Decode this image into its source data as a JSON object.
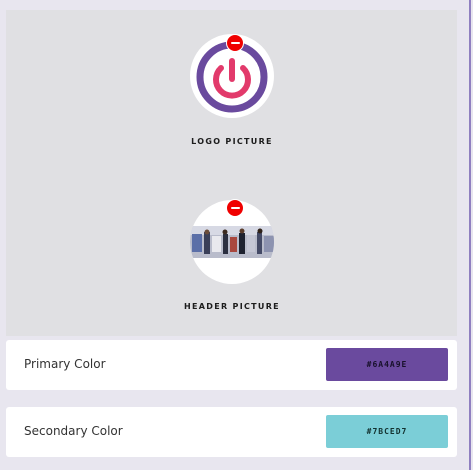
{
  "logo": {
    "label": "LOGO PICTURE",
    "icon": "power-icon",
    "remove_icon": "remove-icon",
    "ring_color": "#6a4a9e",
    "accent_color": "#e23a6b"
  },
  "header": {
    "label": "HEADER PICTURE",
    "image": "header-photo",
    "remove_icon": "remove-icon"
  },
  "colors": {
    "primary": {
      "label": "Primary Color",
      "value": "#6A4A9E",
      "swatch": "#6a4a9e"
    },
    "secondary": {
      "label": "Secondary Color",
      "value": "#7BCED7",
      "swatch": "#7bced7"
    }
  }
}
